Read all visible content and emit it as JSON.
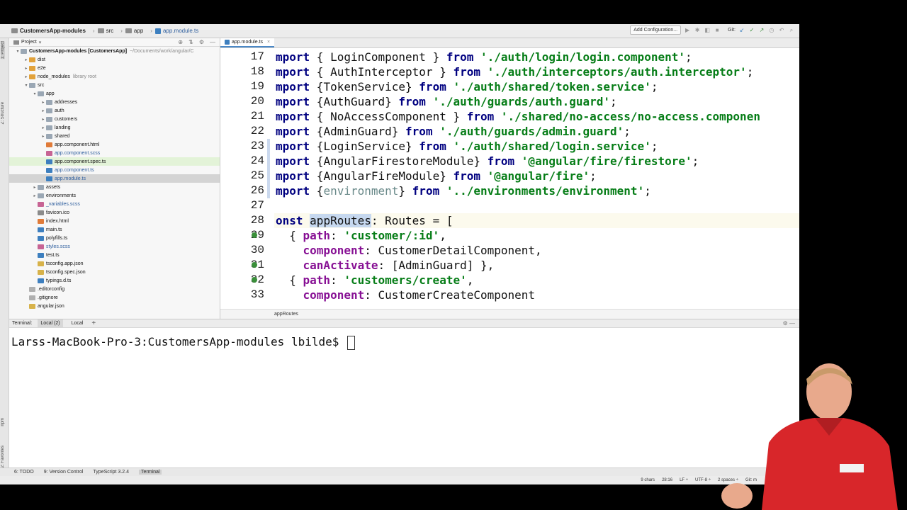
{
  "breadcrumb": {
    "project": "CustomersApp-modules",
    "src": "src",
    "app": "app",
    "file": "app.module.ts"
  },
  "toolbar": {
    "add_configuration": "Add Configuration...",
    "git_label": "Git:"
  },
  "side_tabs": {
    "project": "1: Project",
    "structure": "Z: Structure",
    "npm": "npm",
    "favorites": "2: Favorites"
  },
  "project_panel": {
    "title": "Project",
    "tree": [
      {
        "label": "CustomersApp-modules [CustomersApp]",
        "extra": "~/Documents/work/angular/C",
        "depth": 0,
        "arrow": "▾",
        "icon": "folder",
        "bold": true
      },
      {
        "label": "dist",
        "depth": 1,
        "arrow": "▸",
        "icon": "folder-orange"
      },
      {
        "label": "e2e",
        "depth": 1,
        "arrow": "▸",
        "icon": "folder-orange"
      },
      {
        "label": "node_modules",
        "extra": "library root",
        "depth": 1,
        "arrow": "▸",
        "icon": "folder-orange"
      },
      {
        "label": "src",
        "depth": 1,
        "arrow": "▾",
        "icon": "folder"
      },
      {
        "label": "app",
        "depth": 2,
        "arrow": "▾",
        "icon": "folder"
      },
      {
        "label": "addresses",
        "depth": 3,
        "arrow": "▸",
        "icon": "folder"
      },
      {
        "label": "auth",
        "depth": 3,
        "arrow": "▸",
        "icon": "folder"
      },
      {
        "label": "customers",
        "depth": 3,
        "arrow": "▸",
        "icon": "folder"
      },
      {
        "label": "landing",
        "depth": 3,
        "arrow": "▸",
        "icon": "folder"
      },
      {
        "label": "shared",
        "depth": 3,
        "arrow": "▸",
        "icon": "folder"
      },
      {
        "label": "app.component.html",
        "depth": 3,
        "arrow": "",
        "icon": "file-html"
      },
      {
        "label": "app.component.scss",
        "depth": 3,
        "arrow": "",
        "icon": "file-scss",
        "blue": true
      },
      {
        "label": "app.component.spec.ts",
        "depth": 3,
        "arrow": "",
        "icon": "file-ts",
        "green": true
      },
      {
        "label": "app.component.ts",
        "depth": 3,
        "arrow": "",
        "icon": "file-ts",
        "blue": true
      },
      {
        "label": "app.module.ts",
        "depth": 3,
        "arrow": "",
        "icon": "file-ts",
        "blue": true,
        "selected": true
      },
      {
        "label": "assets",
        "depth": 2,
        "arrow": "▸",
        "icon": "folder"
      },
      {
        "label": "environments",
        "depth": 2,
        "arrow": "▸",
        "icon": "folder"
      },
      {
        "label": "_variables.scss",
        "depth": 2,
        "arrow": "",
        "icon": "file-scss",
        "blue": true
      },
      {
        "label": "favicon.ico",
        "depth": 2,
        "arrow": "",
        "icon": "file-ico"
      },
      {
        "label": "index.html",
        "depth": 2,
        "arrow": "",
        "icon": "file-html"
      },
      {
        "label": "main.ts",
        "depth": 2,
        "arrow": "",
        "icon": "file-ts"
      },
      {
        "label": "polyfills.ts",
        "depth": 2,
        "arrow": "",
        "icon": "file-ts"
      },
      {
        "label": "styles.scss",
        "depth": 2,
        "arrow": "",
        "icon": "file-scss",
        "blue": true
      },
      {
        "label": "test.ts",
        "depth": 2,
        "arrow": "",
        "icon": "file-ts"
      },
      {
        "label": "tsconfig.app.json",
        "depth": 2,
        "arrow": "",
        "icon": "file-json"
      },
      {
        "label": "tsconfig.spec.json",
        "depth": 2,
        "arrow": "",
        "icon": "file-json"
      },
      {
        "label": "typings.d.ts",
        "depth": 2,
        "arrow": "",
        "icon": "file-ts"
      },
      {
        "label": ".editorconfig",
        "depth": 1,
        "arrow": "",
        "icon": "file-git"
      },
      {
        "label": ".gitignore",
        "depth": 1,
        "arrow": "",
        "icon": "file-git"
      },
      {
        "label": "angular.json",
        "depth": 1,
        "arrow": "",
        "icon": "file-json"
      }
    ]
  },
  "editor": {
    "tab_label": "app.module.ts",
    "breadcrumb": "appRoutes",
    "lines": [
      {
        "num": "17",
        "html": "<span class=\"kw\">mport</span> { LoginComponent } <span class=\"kw\">from</span> <span class=\"str\">'./auth/login/login.component'</span>;"
      },
      {
        "num": "18",
        "html": "<span class=\"kw\">mport</span> { AuthInterceptor } <span class=\"kw\">from</span> <span class=\"str\">'./auth/interceptors/auth.interceptor'</span>;"
      },
      {
        "num": "19",
        "html": "<span class=\"kw\">mport</span> {TokenService} <span class=\"kw\">from</span> <span class=\"str\">'./auth/shared/token.service'</span>;"
      },
      {
        "num": "20",
        "html": "<span class=\"kw\">mport</span> {AuthGuard} <span class=\"kw\">from</span> <span class=\"str\">'./auth/guards/auth.guard'</span>;"
      },
      {
        "num": "21",
        "html": "<span class=\"kw\">mport</span> { NoAccessComponent } <span class=\"kw\">from</span> <span class=\"str\">'./shared/no-access/no-access.componen</span>"
      },
      {
        "num": "22",
        "html": "<span class=\"kw\">mport</span> {AdminGuard} <span class=\"kw\">from</span> <span class=\"str\">'./auth/guards/admin.guard'</span>;"
      },
      {
        "num": "23",
        "html": "<span class=\"kw\">mport</span> {LoginService} <span class=\"kw\">from</span> <span class=\"str\">'./auth/shared/login.service'</span>;"
      },
      {
        "num": "24",
        "html": "<span class=\"kw\">mport</span> {AngularFirestoreModule} <span class=\"kw\">from</span> <span class=\"str\">'@angular/fire/firestore'</span>;"
      },
      {
        "num": "25",
        "html": "<span class=\"kw\">mport</span> {AngularFireModule} <span class=\"kw\">from</span> <span class=\"str\">'@angular/fire'</span>;"
      },
      {
        "num": "26",
        "html": "<span class=\"kw\">mport</span> {<span class=\"dim\">environment</span>} <span class=\"kw\">from</span> <span class=\"str\">'../environments/environment'</span>;"
      },
      {
        "num": "27",
        "html": ""
      },
      {
        "num": "28",
        "html": "<span class=\"kw\">onst</span> <span class=\"sel\">appRoutes</span>: Routes = [",
        "current": true
      },
      {
        "num": "29",
        "html": "  { <span class=\"prop\">path</span>: <span class=\"str\">'customer/:id'</span>,",
        "marker": true
      },
      {
        "num": "30",
        "html": "    <span class=\"prop\">component</span>: CustomerDetailComponent,"
      },
      {
        "num": "31",
        "html": "    <span class=\"prop\">canActivate</span>: [AdminGuard] },",
        "marker": true
      },
      {
        "num": "32",
        "html": "  { <span class=\"prop\">path</span>: <span class=\"str\">'customers/create'</span>,",
        "marker": true
      },
      {
        "num": "33",
        "html": "    <span class=\"prop\">component</span>: CustomerCreateComponent"
      }
    ]
  },
  "terminal": {
    "title": "Terminal:",
    "tabs": [
      "Local (2)",
      "Local"
    ],
    "prompt": "Larss-MacBook-Pro-3:CustomersApp-modules lbilde$ "
  },
  "bottom_tabs": [
    "6: TODO",
    "9: Version Control",
    "TypeScript 3.2.4",
    "Terminal"
  ],
  "status": {
    "chars": "9 chars",
    "position": "28:16",
    "line_sep": "LF ÷",
    "encoding": "UTF-8 ÷",
    "indent": "2 spaces ÷",
    "git": "Git: m"
  },
  "colors": {
    "selection": "#c6d8ef",
    "keyword": "#000080",
    "string": "#067d17",
    "property": "#871094"
  }
}
